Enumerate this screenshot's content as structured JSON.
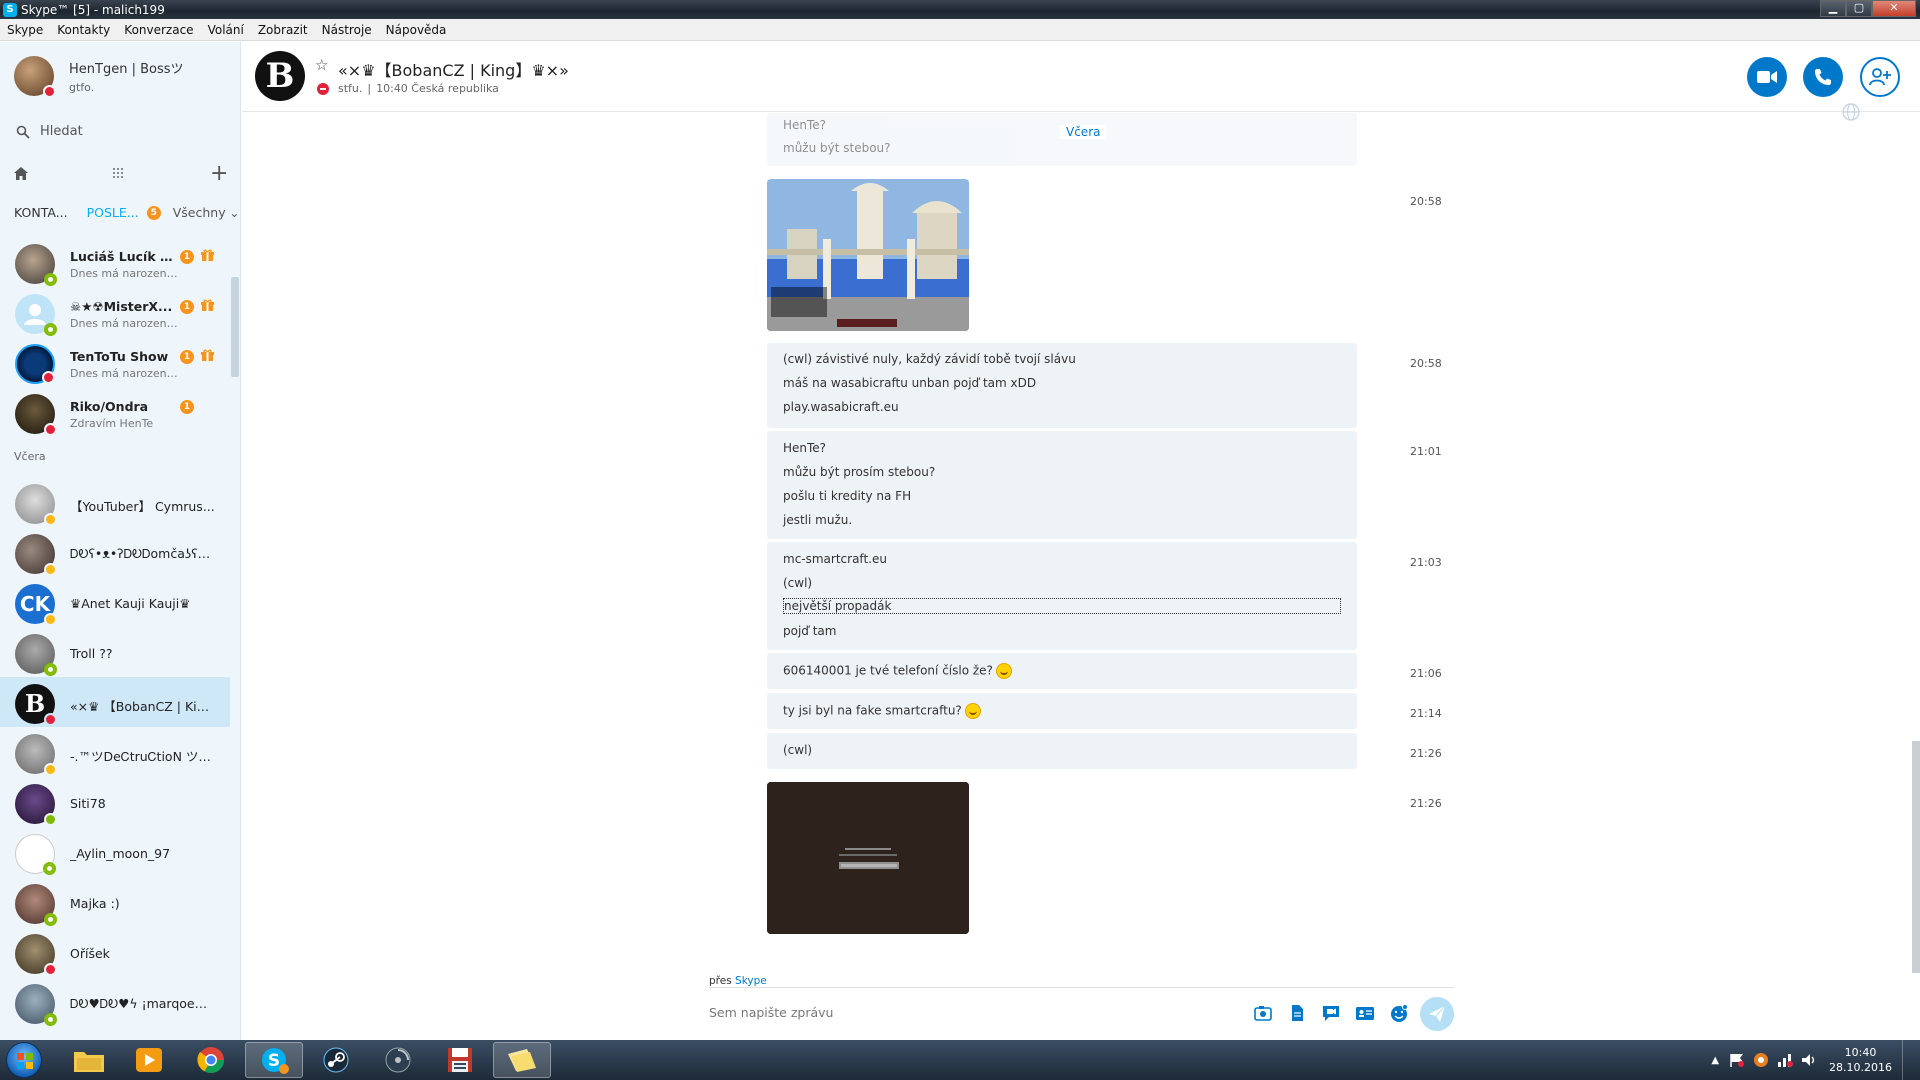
{
  "window": {
    "title": "Skype™ [5] - malich199",
    "minimize": "▁",
    "maximize": "▢",
    "close": "✕"
  },
  "menu": [
    "Skype",
    "Kontakty",
    "Konverzace",
    "Volání",
    "Zobrazit",
    "Nástroje",
    "Nápověda"
  ],
  "profile": {
    "name": "HenTgen | Bossツ",
    "mood": "gtfo."
  },
  "search": {
    "placeholder": "Hledat"
  },
  "tabs": {
    "contacts": "KONTA...",
    "recent": "POSLE...",
    "recent_badge": "5",
    "filter": "Všechny"
  },
  "recent_contacts": [
    {
      "name": "Luciáš Lucík D...",
      "sub": "Dnes má narozeni...",
      "badge": "1",
      "gift": true,
      "status": "online"
    },
    {
      "name": "☠★☢MisterX...",
      "sub": "Dnes má narozeni...",
      "badge": "1",
      "gift": true,
      "status": "online"
    },
    {
      "name": "TenToTu Show",
      "sub": "Dnes má narozeni...",
      "badge": "1",
      "gift": true,
      "status": "busy"
    },
    {
      "name": "Riko/Ondra",
      "sub": "Zdravím HenTe",
      "badge": "1",
      "gift": false,
      "status": "busy"
    }
  ],
  "section_yesterday": "Včera",
  "older_contacts": [
    {
      "name": "【YouTuber】 Cymrus...",
      "status": "away"
    },
    {
      "name": "ᎠᎧʕ•ᴥ•ʔᎠᎧᎠomčaʖʕ•ᴥ•...",
      "status": "away"
    },
    {
      "name": "♛Anet Kauji Kauji♛",
      "status": "away"
    },
    {
      "name": "Troll ??",
      "status": "offline"
    },
    {
      "name": "«×♛ 【BobanCZ | Kin...",
      "status": "busy",
      "selected": true
    },
    {
      "name": "-.™ツDeᏟtruᏟtioꓠ ツ℗ᵘᶜᵏ...",
      "status": "away"
    },
    {
      "name": "Siti78",
      "status": "online"
    },
    {
      "name": "_Aylin_moon_97",
      "status": "offline"
    },
    {
      "name": "Majka :)",
      "status": "offline"
    },
    {
      "name": "Oříšek",
      "status": "busy"
    },
    {
      "name": "ᎠᎧ♥ᎠᎧ♥ϟ ¡marqoeϟ♥...",
      "status": "offline"
    }
  ],
  "chat_header": {
    "name": "«×♛【BobanCZ | King】♛×»",
    "mood": "stfu.",
    "separator": "|",
    "local_time": "10:40 Česká republika"
  },
  "chat": {
    "day_label": "Včera",
    "partial_top": [
      "HenTe?",
      "můžu být stebou?"
    ],
    "messages": [
      {
        "time": "20:58",
        "type": "image"
      },
      {
        "time": "20:58",
        "lines": [
          "(cwl) závistivé nuly, každý závidí tobě tvojí slávu",
          "máš na wasabicraftu unban pojď tam xDD",
          "play.wasabicraft.eu"
        ]
      },
      {
        "time": "21:01",
        "lines": [
          "HenTe?",
          "můžu být prosím stebou?",
          "pošlu ti kredity na FH",
          "jestli mužu."
        ]
      },
      {
        "time": "21:03",
        "lines": [
          "mc-smartcraft.eu",
          "(cwl)",
          "největší propadák",
          "pojď tam"
        ]
      },
      {
        "time": "21:06",
        "lines": [
          "606140001 je tvé telefoní číslo že?"
        ],
        "emoticon": true
      },
      {
        "time": "21:14",
        "lines": [
          "ty jsi byl na fake smartcraftu?"
        ],
        "emoticon": true
      },
      {
        "time": "21:26",
        "lines": [
          "(cwl)"
        ]
      },
      {
        "time": "21:26",
        "type": "image"
      }
    ]
  },
  "via": {
    "prefix": "přes",
    "app": "Skype"
  },
  "composer": {
    "placeholder": "Sem napište zprávu"
  },
  "clock": {
    "time": "10:40",
    "date": "28.10.2016"
  },
  "colors": {
    "accent": "#0078ca",
    "skype": "#00aff0",
    "busy": "#e2223b",
    "online": "#7fba00",
    "away": "#fdb813",
    "badge": "#f7941d"
  }
}
